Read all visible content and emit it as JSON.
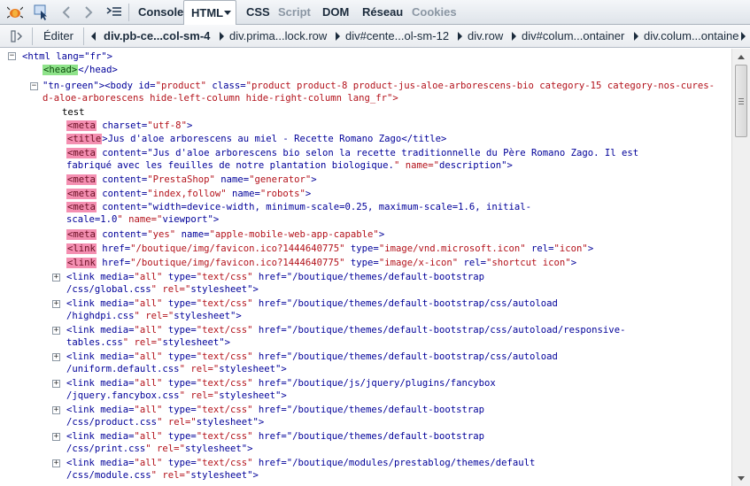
{
  "toolbar": {
    "tabs": [
      {
        "label": "Console"
      },
      {
        "label": "HTML"
      },
      {
        "label": "CSS"
      },
      {
        "label": "Script"
      },
      {
        "label": "DOM"
      },
      {
        "label": "Réseau"
      },
      {
        "label": "Cookies"
      }
    ]
  },
  "crumbs": {
    "edit_label": "Éditer",
    "items": [
      "div.pb-ce...col-sm-4",
      "div.prima...lock.row",
      "div#cente...ol-sm-12",
      "div.row",
      "div#colum...ontainer",
      "div.colum...ontaine"
    ]
  },
  "code": {
    "html_open": "<html lang=\"fr\">",
    "head": "<head></head>",
    "body_line1": "<body id=\"product\" class=\"product product-8 product-jus-aloe-arborescens-bio category-15 category-nos-cures-",
    "body_line2": "d-aloe-arborescens hide-left-column hide-right-column lang_fr\">",
    "text_node": "test",
    "lines": [
      "<meta charset=\"utf-8\">",
      "<title>Jus d'aloe arborescens au miel - Recette Romano Zago</title>",
      "<meta content=\"Jus d'aloe arborescens bio selon la recette traditionnelle du Père Romano Zago. Il est",
      "fabriqué avec les feuilles de notre plantation biologique.\" name=\"description\">",
      "<meta content=\"PrestaShop\" name=\"generator\">",
      "<meta content=\"index,follow\" name=\"robots\">",
      "<meta content=\"width=device-width, minimum-scale=0.25, maximum-scale=1.6, initial-",
      "scale=1.0\" name=\"viewport\">",
      "<meta content=\"yes\" name=\"apple-mobile-web-app-capable\">",
      "<link href=\"/boutique/img/favicon.ico?1444640775\" type=\"image/vnd.microsoft.icon\" rel=\"icon\">",
      "<link href=\"/boutique/img/favicon.ico?1444640775\" type=\"image/x-icon\" rel=\"shortcut icon\">",
      "<link media=\"all\" type=\"text/css\" href=\"/boutique/themes/default-bootstrap",
      "/css/global.css\" rel=\"stylesheet\">",
      "<link media=\"all\" type=\"text/css\" href=\"/boutique/themes/default-bootstrap/css/autoload",
      "/highdpi.css\" rel=\"stylesheet\">",
      "<link media=\"all\" type=\"text/css\" href=\"/boutique/themes/default-bootstrap/css/autoload/responsive-",
      "tables.css\" rel=\"stylesheet\">",
      "<link media=\"all\" type=\"text/css\" href=\"/boutique/themes/default-bootstrap/css/autoload",
      "/uniform.default.css\" rel=\"stylesheet\">",
      "<link media=\"all\" type=\"text/css\" href=\"/boutique/js/jquery/plugins/fancybox",
      "/jquery.fancybox.css\" rel=\"stylesheet\">",
      "<link media=\"all\" type=\"text/css\" href=\"/boutique/themes/default-bootstrap",
      "/css/product.css\" rel=\"stylesheet\">",
      "<link media=\"all\" type=\"text/css\" href=\"/boutique/themes/default-bootstrap",
      "/css/print.css\" rel=\"stylesheet\">",
      "<link media=\"all\" type=\"text/css\" href=\"/boutique/modules/prestablog/themes/default",
      "/css/module.css\" rel=\"stylesheet\">"
    ]
  },
  "icons": {
    "firebug": "firebug-icon",
    "inspect": "inspect-icon",
    "back": "back-icon",
    "forward": "forward-icon",
    "command_line": "command-line-icon"
  },
  "colors": {
    "tag": "#000099",
    "attr_value": "#b3121b",
    "tag_highlight": "#f48fb1",
    "head_highlight": "#8fe38a"
  }
}
